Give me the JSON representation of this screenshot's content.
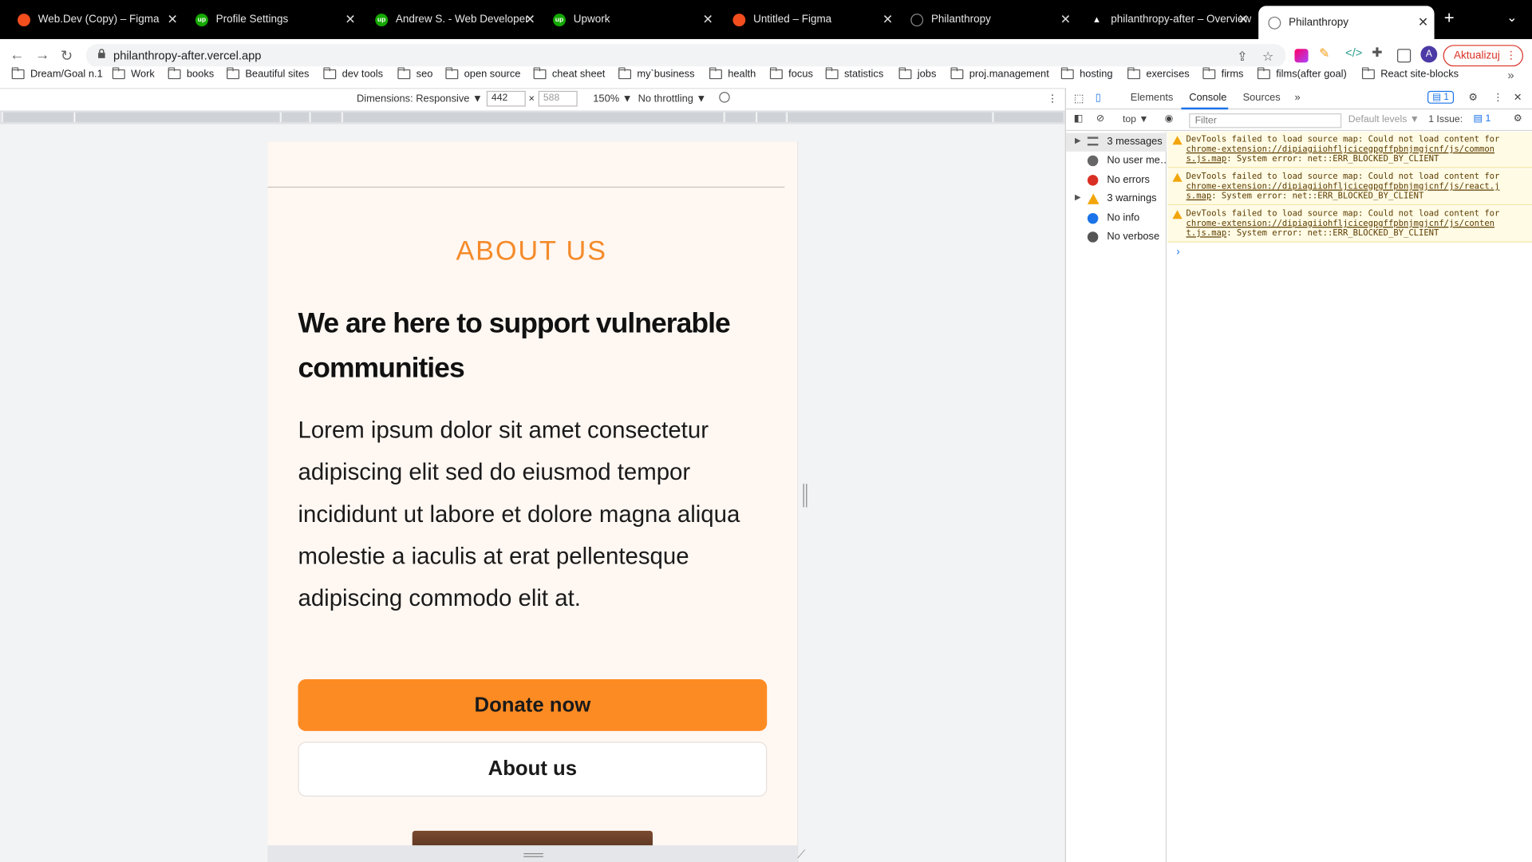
{
  "tabs": [
    {
      "title": "Web.Dev (Copy) – Figma",
      "icon": "figma-icon",
      "color": "#f24e1e"
    },
    {
      "title": "Profile Settings",
      "icon": "upwork-icon",
      "color": "#14a800"
    },
    {
      "title": "Andrew S. - Web Developer",
      "icon": "upwork-icon",
      "color": "#14a800"
    },
    {
      "title": "Upwork",
      "icon": "upwork-icon",
      "color": "#14a800"
    },
    {
      "title": "Untitled – Figma",
      "icon": "figma-icon",
      "color": "#f24e1e"
    },
    {
      "title": "Philanthropy",
      "icon": "globe-icon",
      "color": "#777777"
    },
    {
      "title": "philanthropy-after – Overview",
      "icon": "vercel-icon",
      "color": "#ffffff"
    },
    {
      "title": "Philanthropy",
      "icon": "globe-icon",
      "color": "#777777"
    }
  ],
  "toolbar": {
    "url": "philanthropy-after.vercel.app",
    "update_label": "Aktualizuj",
    "profile_initial": "A"
  },
  "bookmarks": [
    "Dream/Goal n.1",
    "Work",
    "books",
    "Beautiful sites",
    "dev tools",
    "seo",
    "open source",
    "cheat sheet",
    "my`business",
    "health",
    "focus",
    "statistics",
    "jobs",
    "proj.management",
    "hosting",
    "exercises",
    "firms",
    "films(after goal)",
    "React site-blocks"
  ],
  "device_toolbar": {
    "dimensions_label": "Dimensions: Responsive ▼",
    "width": "442",
    "height": "588",
    "zoom": "150% ▼",
    "throttling": "No throttling ▼"
  },
  "page": {
    "section_label": "ABOUT US",
    "headline": "We are here to support vulnerable communities",
    "body": "Lorem ipsum dolor sit amet consectetur adipiscing elit sed do eiusmod tempor incididunt ut labore et dolore magna aliqua molestie a iaculis at erat pellentesque adipiscing commodo elit at.",
    "primary_button": "Donate now",
    "secondary_button": "About us",
    "accent_color": "#fd8b23"
  },
  "devtools": {
    "tabs": [
      "Elements",
      "Console",
      "Sources"
    ],
    "active_tab": "Console",
    "issues_badge": "1",
    "context": "top ▼",
    "filter_placeholder": "Filter",
    "levels": "Default levels ▼",
    "issue_label": "1 Issue:",
    "issue_count": "1",
    "sidebar": [
      "3 messages",
      "No user me…",
      "No errors",
      "3 warnings",
      "No info",
      "No verbose"
    ],
    "messages": [
      {
        "prefix": "DevTools failed to load source map: Could not load content for ",
        "link": "chrome-extension://dipiagiiohfljcicegpgffpbnjmgjcnf/js/common s.js.map",
        "suffix": ": System error: net::ERR_BLOCKED_BY_CLIENT"
      },
      {
        "prefix": "DevTools failed to load source map: Could not load content for ",
        "link": "chrome-extension://dipiagiiohfljcicegpgffpbnjmgjcnf/js/react.j s.map",
        "suffix": ": System error: net::ERR_BLOCKED_BY_CLIENT"
      },
      {
        "prefix": "DevTools failed to load source map: Could not load content for ",
        "link": "chrome-extension://dipiagiiohfljcicegpgffpbnjmgjcnf/js/conten t.js.map",
        "suffix": ": System error: net::ERR_BLOCKED_BY_CLIENT"
      }
    ]
  }
}
